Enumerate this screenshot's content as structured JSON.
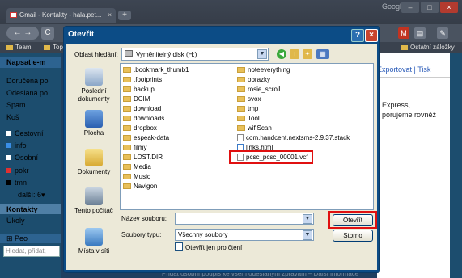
{
  "browser": {
    "tab_title": "Gmail - Kontakty - hala.pet...",
    "tab_close": "×",
    "new_tab": "+",
    "brand": "Google",
    "win_min": "–",
    "win_max": "□",
    "win_close": "×",
    "nav_back": "←",
    "nav_forward": "→",
    "reload": "C",
    "bookmarks": [
      "Team",
      "Top"
    ],
    "other_bookmarks": "Ostatní záložky"
  },
  "gmail": {
    "compose": "Napsat e-m",
    "nav": [
      "Doručená po",
      "Odeslaná po",
      "Spam",
      "Koš"
    ],
    "labels": [
      {
        "text": "Cestovní",
        "color": "#ffffff"
      },
      {
        "text": "info",
        "color": "#3a8ee6"
      },
      {
        "text": "Osobní",
        "color": "#ffffff"
      },
      {
        "text": "pokr",
        "color": "#e03030"
      },
      {
        "text": "tmn",
        "color": "#000000"
      }
    ],
    "more": "další: 6▾",
    "kontakty": "Kontakty",
    "ukoly": "Úkoly",
    "people": "Peo",
    "people_search": "Hledat, přidat,",
    "right_head": "Exportovat | Tisk",
    "right_text_1": "Express,",
    "right_text_2": "porujeme rovněž",
    "bottom_text": "Přidat osobní podpis ke všem odeslaným zprávám – Další informace"
  },
  "dialog": {
    "title": "Otevřít",
    "help": "?",
    "close": "×",
    "lookin_label": "Oblast hledání:",
    "lookin_value": "Vyměnitelný disk (H:)",
    "places": [
      "Poslední dokumenty",
      "Plocha",
      "Dokumenty",
      "Tento počítač",
      "Místa v síti"
    ],
    "files_col1": [
      ".bookmark_thumb1",
      ".footprints",
      "backup",
      "DCIM",
      "download",
      "downloads",
      "dropbox",
      "espeak-data",
      "filmy",
      "LOST.DIR",
      "Media",
      "Music",
      "Navigon"
    ],
    "files_col2": [
      {
        "name": "noteeverything",
        "kind": "folder"
      },
      {
        "name": "obrazky",
        "kind": "folder"
      },
      {
        "name": "rosie_scroll",
        "kind": "folder"
      },
      {
        "name": "svox",
        "kind": "folder"
      },
      {
        "name": "tmp",
        "kind": "folder"
      },
      {
        "name": "Tool",
        "kind": "folder"
      },
      {
        "name": "wifiScan",
        "kind": "folder"
      },
      {
        "name": "com.handcent.nextsms-2.9.37.stack",
        "kind": "doc"
      },
      {
        "name": "links.html",
        "kind": "html"
      },
      {
        "name": "pcsc_pcsc_00001.vcf",
        "kind": "doc"
      }
    ],
    "filename_label": "Název souboru:",
    "filename_value": "",
    "filetype_label": "Soubory typu:",
    "filetype_value": "Všechny soubory",
    "readonly_label": "Otevřít jen pro čtení",
    "open_button": "Otevřít",
    "cancel_button": "Storno"
  },
  "colors": {
    "dialog_frame": "#0c4c86",
    "highlight": "#e01010",
    "gmail_nav": "#1c4d6e"
  }
}
